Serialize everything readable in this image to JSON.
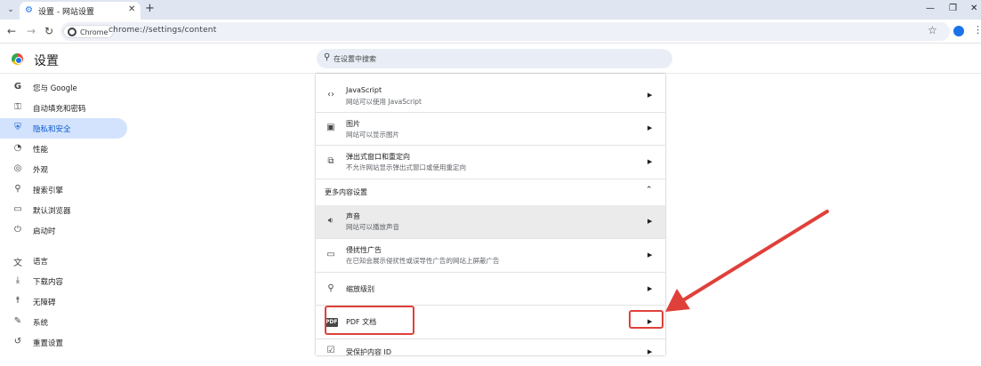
{
  "browser": {
    "tab_title": "设置 - 网站设置",
    "chip_label": "Chrome",
    "url": "chrome://settings/content"
  },
  "header": {
    "title": "设置",
    "search_placeholder": "在设置中搜索"
  },
  "sidebar": {
    "items": [
      {
        "label": "您与 Google",
        "icon": "google-g-icon",
        "active": false
      },
      {
        "label": "自动填充和密码",
        "icon": "key-icon",
        "active": false
      },
      {
        "label": "隐私和安全",
        "icon": "shield-icon",
        "active": true
      },
      {
        "label": "性能",
        "icon": "speedometer-icon",
        "active": false
      },
      {
        "label": "外观",
        "icon": "palette-icon",
        "active": false
      },
      {
        "label": "搜索引擎",
        "icon": "search-icon",
        "active": false
      },
      {
        "label": "默认浏览器",
        "icon": "browser-window-icon",
        "active": false
      },
      {
        "label": "启动时",
        "icon": "power-icon",
        "active": false
      },
      {
        "label": "语言",
        "icon": "translate-icon",
        "active": false
      },
      {
        "label": "下载内容",
        "icon": "download-icon",
        "active": false
      },
      {
        "label": "无障碍",
        "icon": "accessibility-icon",
        "active": false
      },
      {
        "label": "系统",
        "icon": "wrench-icon",
        "active": false
      },
      {
        "label": "重置设置",
        "icon": "reset-icon",
        "active": false
      }
    ]
  },
  "content": {
    "rows_top": [
      {
        "title": "JavaScript",
        "subtitle": "网站可以使用 JavaScript",
        "icon": "code-icon"
      },
      {
        "title": "图片",
        "subtitle": "网站可以显示图片",
        "icon": "image-icon"
      },
      {
        "title": "弹出式窗口和重定向",
        "subtitle": "不允许网站显示弹出式窗口或使用重定向",
        "icon": "popup-icon"
      }
    ],
    "section_title": "更多内容设置",
    "rows_more": [
      {
        "title": "声音",
        "subtitle": "网站可以播放声音",
        "icon": "speaker-icon",
        "highlighted": true
      },
      {
        "title": "侵扰性广告",
        "subtitle": "在已知会展示侵扰性或误导性广告的网站上屏蔽广告",
        "icon": "ad-icon",
        "highlighted": false
      },
      {
        "title": "缩放级别",
        "subtitle": "",
        "icon": "zoom-icon",
        "highlighted": false
      },
      {
        "title": "PDF 文档",
        "subtitle": "",
        "icon": "pdf-icon",
        "highlighted": false
      },
      {
        "title": "受保护内容 ID",
        "subtitle": "",
        "icon": "protected-content-icon",
        "highlighted": false
      }
    ]
  },
  "annotation": {
    "color": "#e0403a"
  }
}
